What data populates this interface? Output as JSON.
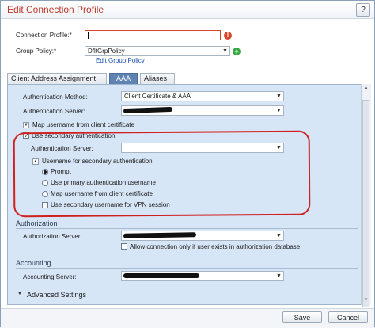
{
  "dialog": {
    "title": "Edit Connection Profile",
    "help_icon": "question-mark-icon",
    "accent_color": "#c0392b"
  },
  "top_form": {
    "connection_profile_label": "Connection Profile:*",
    "connection_profile_value": "",
    "group_policy_label": "Group Policy:*",
    "group_policy_value": "DfltGrpPolicy",
    "edit_group_policy_link": "Edit Group Policy"
  },
  "tabs": [
    {
      "label": "Client Address Assignment",
      "active": false
    },
    {
      "label": "AAA",
      "active": true
    },
    {
      "label": "Aliases",
      "active": false
    }
  ],
  "aaa": {
    "auth_method_label": "Authentication Method:",
    "auth_method_value": "Client Certificate & AAA",
    "auth_server_label": "Authentication Server:",
    "map_username_label": "Map username from client certificate",
    "use_secondary_label": "Use secondary authentication",
    "use_secondary_checked": true,
    "secondary_auth_server_label": "Authentication Server:",
    "secondary_auth_server_value": "",
    "username_secondary_label": "Username for secondary authentication",
    "radio_options": [
      {
        "label": "Prompt",
        "selected": true
      },
      {
        "label": "Use primary authentication username",
        "selected": false
      },
      {
        "label": "Map username from client certificate",
        "selected": false
      }
    ],
    "use_secondary_vpn_label": "Use secondary username for VPN session",
    "use_secondary_vpn_checked": false
  },
  "authorization": {
    "section_label": "Authorization",
    "server_label": "Authorization Server:",
    "allow_label": "Allow connection only if user exists in authorization database",
    "allow_checked": false
  },
  "accounting": {
    "section_label": "Accounting",
    "server_label": "Accounting Server:"
  },
  "advanced": {
    "label": "Advanced Settings"
  },
  "footer": {
    "save_label": "Save",
    "cancel_label": "Cancel"
  }
}
